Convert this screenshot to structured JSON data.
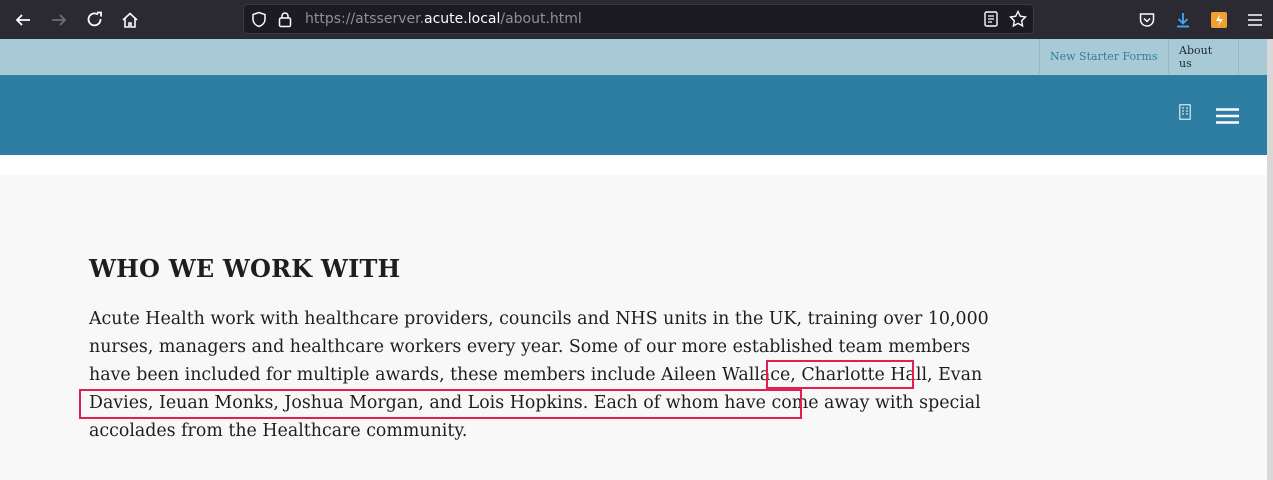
{
  "browser": {
    "url_prefix": "https://atsserver.",
    "url_host": "acute.local",
    "url_path": "/about.html"
  },
  "topbar": {
    "links": [
      {
        "label": "New Starter Forms"
      },
      {
        "label": "About us"
      }
    ]
  },
  "main": {
    "heading": "WHO WE WORK WITH",
    "paragraph_parts": [
      "Acute Health work with healthcare providers, councils and NHS units in the UK, training over 10,000 nurses, managers and healthcare workers every year. Some of our more established team members have been included for multiple awards, these members include",
      " Aileen Wallace, Charlotte Hall, Evan Davies, Ieuan Monks, Joshua Morgan, and Lois Hopkins.",
      " Each of whom have come away with special accolades from the Healthcare community."
    ]
  },
  "colors": {
    "header": "#2e7ea3",
    "utility_bar": "#a8cad7",
    "highlight": "#e0214f"
  }
}
